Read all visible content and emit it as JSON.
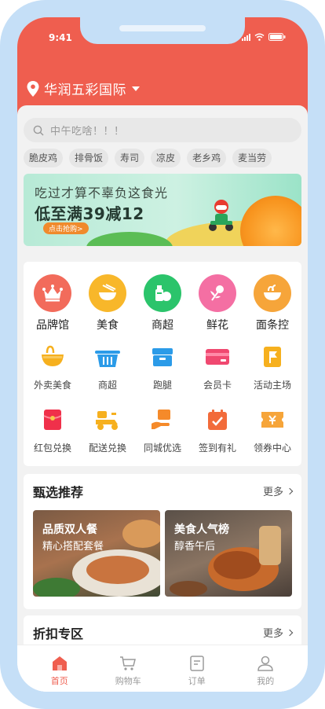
{
  "status_bar": {
    "time": "9:41"
  },
  "location": {
    "name": "华润五彩国际"
  },
  "search": {
    "placeholder": "中午吃啥！！！"
  },
  "hot_tags": [
    "脆皮鸡",
    "排骨饭",
    "寿司",
    "凉皮",
    "老乡鸡",
    "麦当劳"
  ],
  "banner": {
    "line1": "吃过才算不辜负这食光",
    "line2": "低至满39减12",
    "cta": "点击抢购>"
  },
  "main_categories": [
    {
      "label": "品牌馆",
      "icon": "crown-icon",
      "color": "#f26b5b"
    },
    {
      "label": "美食",
      "icon": "bowl-chopsticks-icon",
      "color": "#f8b72a"
    },
    {
      "label": "商超",
      "icon": "supermarket-icon",
      "color": "#2bc46b"
    },
    {
      "label": "鲜花",
      "icon": "flower-icon",
      "color": "#f46fa3"
    },
    {
      "label": "面条控",
      "icon": "noodle-bowl-icon",
      "color": "#f6a53a"
    }
  ],
  "services_row1": [
    {
      "label": "外卖美食",
      "icon": "takeout-bowl-icon"
    },
    {
      "label": "商超",
      "icon": "basket-icon"
    },
    {
      "label": "跑腿",
      "icon": "box-icon"
    },
    {
      "label": "会员卡",
      "icon": "member-card-icon"
    },
    {
      "label": "活动主场",
      "icon": "flag-icon"
    }
  ],
  "services_row2": [
    {
      "label": "红包兑换",
      "icon": "red-envelope-icon"
    },
    {
      "label": "配送兑换",
      "icon": "scooter-icon"
    },
    {
      "label": "同城优选",
      "icon": "hand-box-icon"
    },
    {
      "label": "签到有礼",
      "icon": "calendar-check-icon"
    },
    {
      "label": "领券中心",
      "icon": "coupon-icon"
    }
  ],
  "featured": {
    "title": "甄选推荐",
    "more": "更多",
    "cards": [
      {
        "title": "品质双人餐",
        "subtitle": "精心搭配套餐"
      },
      {
        "title": "美食人气榜",
        "subtitle": "醇香午后"
      }
    ]
  },
  "discount": {
    "title": "折扣专区",
    "more": "更多"
  },
  "tabbar": [
    {
      "label": "首页",
      "icon": "home-icon",
      "active": true
    },
    {
      "label": "购物车",
      "icon": "cart-icon",
      "active": false
    },
    {
      "label": "订单",
      "icon": "order-icon",
      "active": false
    },
    {
      "label": "我的",
      "icon": "user-icon",
      "active": false
    }
  ],
  "colors": {
    "brand": "#ef5e4f",
    "frame": "#c5dff7"
  }
}
